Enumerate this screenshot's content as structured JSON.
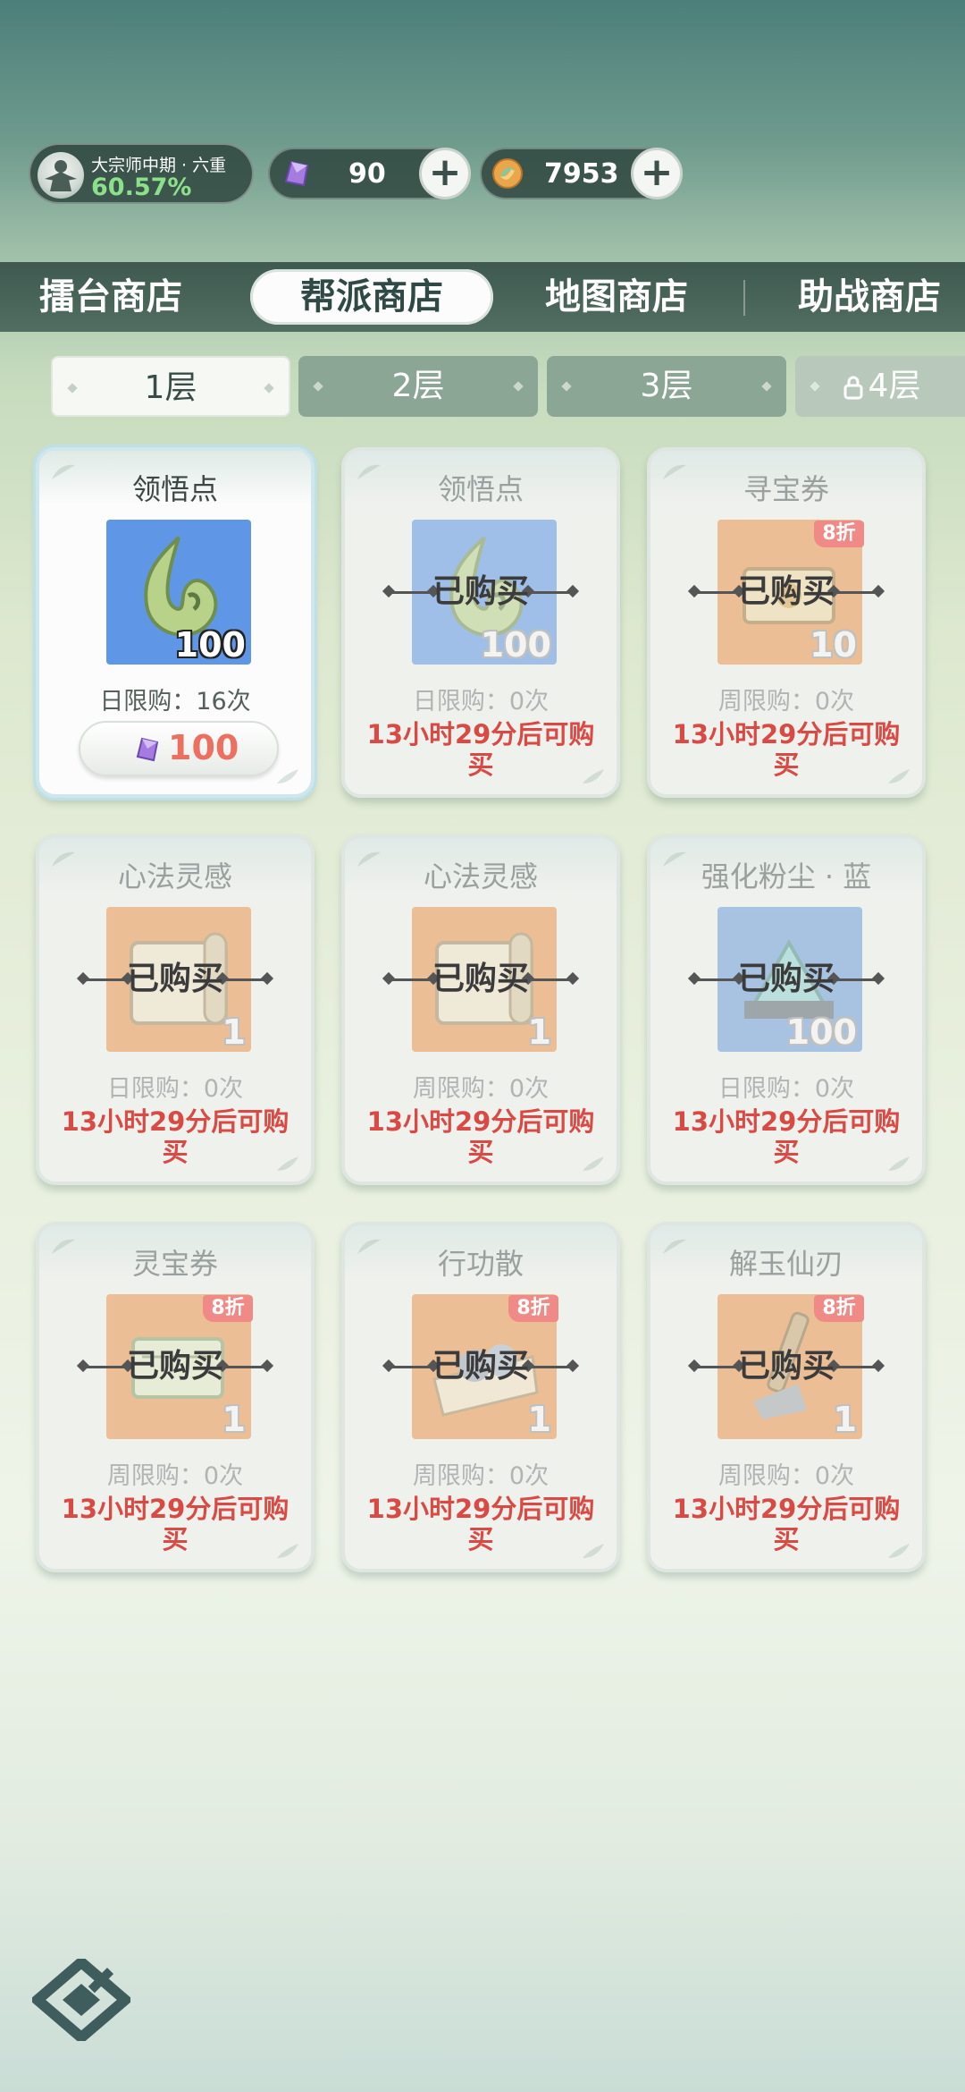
{
  "player": {
    "realm": "大宗师中期 · 六重",
    "progress": "60.57%",
    "currencies": [
      {
        "name": "purple-crystal",
        "value": "90"
      },
      {
        "name": "gold-coin",
        "value": "7953"
      }
    ]
  },
  "shop_tabs": [
    "擂台商店",
    "帮派商店",
    "地图商店",
    "助战商店"
  ],
  "active_shop_tab": 1,
  "floor_tabs": [
    "1层",
    "2层",
    "3层",
    "4层"
  ],
  "active_floor": 0,
  "sold_label": "已购买",
  "items": [
    {
      "name": "领悟点",
      "qty": "100",
      "limit": "日限购：16次",
      "price": "100",
      "state": "available",
      "discount": "",
      "icon": "jade-drop-icon",
      "bg": "#5f97e6"
    },
    {
      "name": "领悟点",
      "qty": "100",
      "limit": "日限购：0次",
      "restock": "13小时29分后可购买",
      "state": "sold",
      "discount": "",
      "icon": "jade-drop-icon",
      "bg": "#5f97e6"
    },
    {
      "name": "寻宝券",
      "qty": "10",
      "limit": "周限购：0次",
      "restock": "13小时29分后可购买",
      "state": "sold",
      "discount": "8折",
      "icon": "treasure-ticket-icon",
      "bg": "#e9964e"
    },
    {
      "name": "心法灵感",
      "qty": "1",
      "limit": "日限购：0次",
      "restock": "13小时29分后可购买",
      "state": "sold",
      "discount": "",
      "icon": "scroll-icon",
      "bg": "#e9964e"
    },
    {
      "name": "心法灵感",
      "qty": "1",
      "limit": "周限购：0次",
      "restock": "13小时29分后可购买",
      "state": "sold",
      "discount": "",
      "icon": "scroll-icon",
      "bg": "#e9964e"
    },
    {
      "name": "强化粉尘 · 蓝",
      "qty": "100",
      "limit": "日限购：0次",
      "restock": "13小时29分后可购买",
      "state": "sold",
      "discount": "",
      "icon": "blue-dust-icon",
      "bg": "#6f9fd8"
    },
    {
      "name": "灵宝券",
      "qty": "1",
      "limit": "周限购：0次",
      "restock": "13小时29分后可购买",
      "state": "sold",
      "discount": "8折",
      "icon": "green-ticket-icon",
      "bg": "#e9964e"
    },
    {
      "name": "行功散",
      "qty": "1",
      "limit": "周限购：0次",
      "restock": "13小时29分后可购买",
      "state": "sold",
      "discount": "8折",
      "icon": "pill-bundle-icon",
      "bg": "#e9964e"
    },
    {
      "name": "解玉仙刃",
      "qty": "1",
      "limit": "周限购：0次",
      "restock": "13小时29分后可购买",
      "state": "sold",
      "discount": "8折",
      "icon": "carving-knife-icon",
      "bg": "#e9964e"
    }
  ]
}
